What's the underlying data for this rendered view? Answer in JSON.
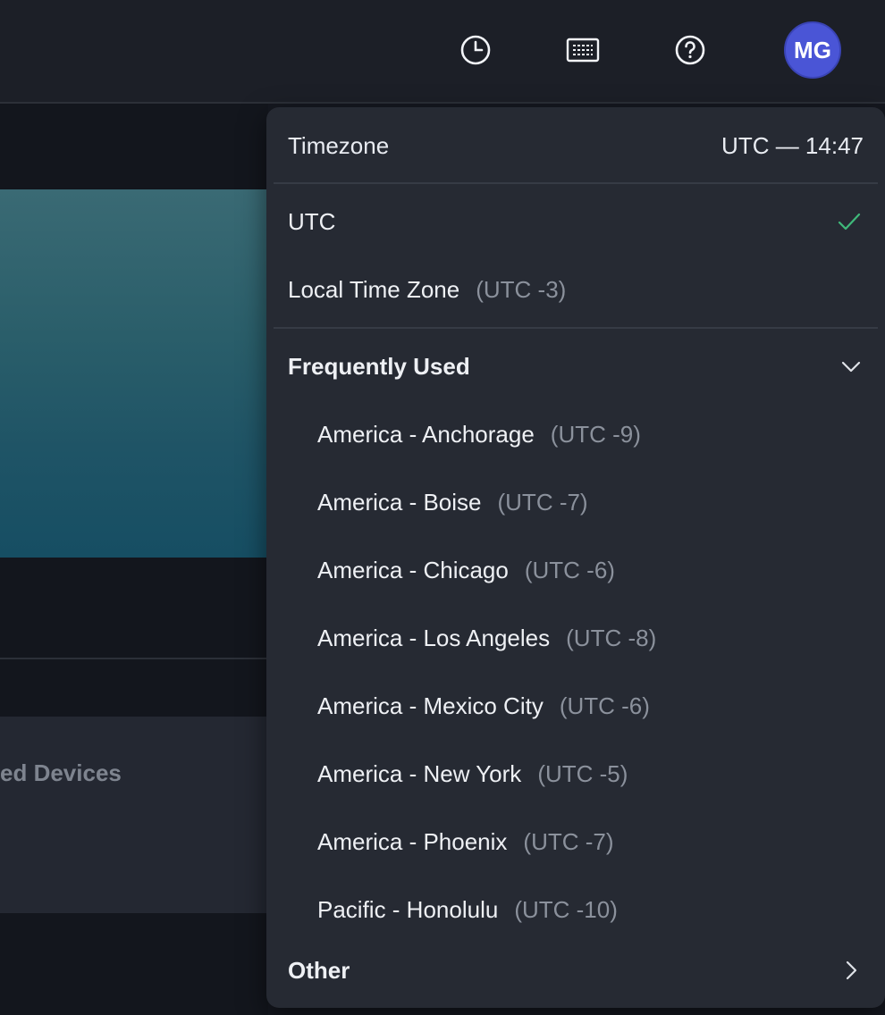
{
  "topbar": {
    "icons": [
      {
        "name": "clock-icon"
      },
      {
        "name": "keyboard-icon"
      },
      {
        "name": "help-icon"
      }
    ],
    "avatar_initials": "MG"
  },
  "background": {
    "card_title": "ed Devices"
  },
  "timezone_menu": {
    "header_label": "Timezone",
    "current_time": "UTC — 14:47",
    "options": [
      {
        "label": "UTC",
        "offset": "",
        "selected": true
      },
      {
        "label": "Local Time Zone",
        "offset": "(UTC -3)",
        "selected": false
      }
    ],
    "frequently_used": {
      "label": "Frequently Used",
      "items": [
        {
          "label": "America - Anchorage",
          "offset": "(UTC -9)"
        },
        {
          "label": "America - Boise",
          "offset": "(UTC -7)"
        },
        {
          "label": "America - Chicago",
          "offset": "(UTC -6)"
        },
        {
          "label": "America - Los Angeles",
          "offset": "(UTC -8)"
        },
        {
          "label": "America - Mexico City",
          "offset": "(UTC -6)"
        },
        {
          "label": "America - New York",
          "offset": "(UTC -5)"
        },
        {
          "label": "America - Phoenix",
          "offset": "(UTC -7)"
        },
        {
          "label": "Pacific - Honolulu",
          "offset": "(UTC -10)"
        }
      ]
    },
    "other_label": "Other"
  },
  "colors": {
    "accent_check": "#3fb97a",
    "avatar_bg": "#4a55d6"
  }
}
